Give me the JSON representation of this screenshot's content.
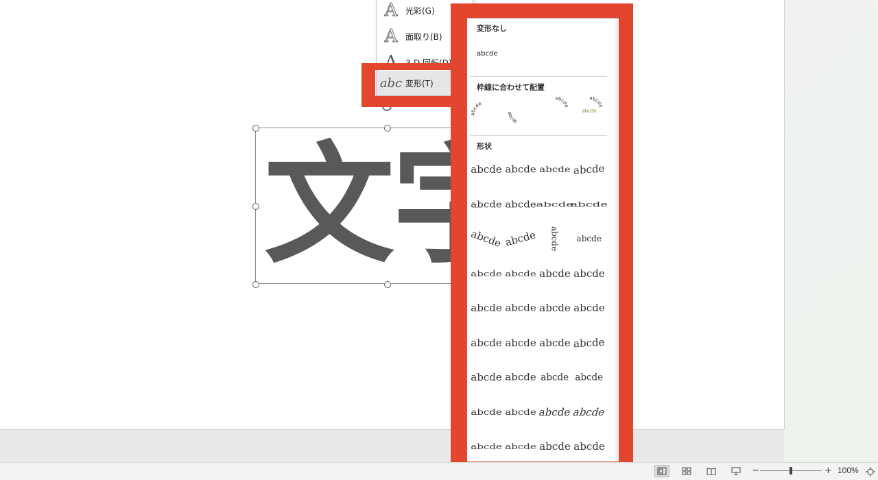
{
  "slide": {
    "text": "文字"
  },
  "menu": {
    "items": [
      {
        "icon": "A",
        "label": "光彩(G)"
      },
      {
        "icon": "A",
        "label": "面取り(B)"
      },
      {
        "icon": "A",
        "label": "3-D 回転(D)"
      },
      {
        "icon": "abc",
        "label": "変形(T)"
      }
    ]
  },
  "panel": {
    "section_none": "変形なし",
    "none_sample": "abcde",
    "section_follow": "枠線に合わせて配置",
    "section_shape": "形状",
    "sample": "abcde",
    "shape_samples": [
      "abcde",
      "abcde",
      "abcde",
      "abcde",
      "abcde",
      "abcde",
      "abcde",
      "abcde",
      "abcde",
      "abcde",
      "abcde",
      "abcde",
      "abcde",
      "abcde",
      "abcde",
      "abcde",
      "abcde",
      "abcde",
      "abcde",
      "abcde",
      "abcde",
      "abcde",
      "abcde",
      "abcde",
      "abcde",
      "abcde",
      "abcde",
      "abcde",
      "abcde",
      "abcde",
      "abcde",
      "abcde",
      "abcde",
      "abcde",
      "abcde",
      "abcde"
    ]
  },
  "status": {
    "zoom": "100%"
  },
  "colors": {
    "highlight": "#e3462f",
    "text": "#595959"
  }
}
